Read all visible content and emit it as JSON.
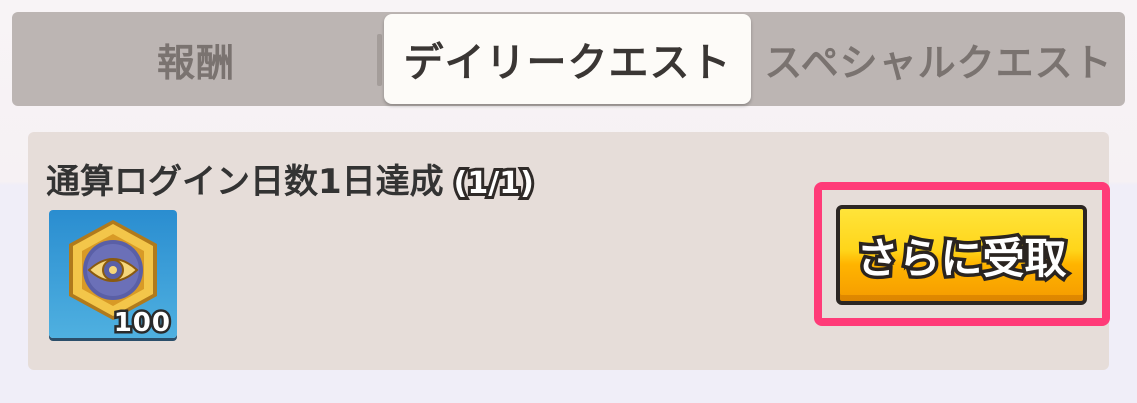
{
  "tabs": {
    "rewards": "報酬",
    "daily_quest": "デイリークエスト",
    "special_quest": "スペシャルクエスト"
  },
  "quest": {
    "title": "通算ログイン日数1日達成",
    "progress": "(1/1)",
    "reward": {
      "icon": "eye-medal-icon",
      "count": "100"
    },
    "claim_label": "さらに受取"
  },
  "colors": {
    "highlight": "#ff3b78",
    "button": "#ffc800",
    "card": "#e6ddd9",
    "tabbar": "#bcb5b3"
  }
}
